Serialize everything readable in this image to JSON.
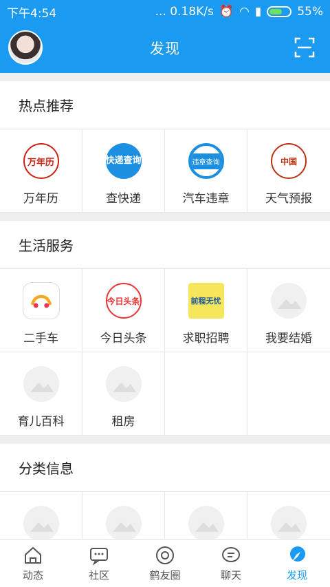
{
  "status": {
    "time": "下午4:54",
    "network": "... 0.18K/s",
    "battery": "55%"
  },
  "appbar": {
    "title": "发现"
  },
  "sections": [
    {
      "title": "热点推荐",
      "items": [
        {
          "label": "万年历",
          "icon": "calendar-icon",
          "text": "万年历"
        },
        {
          "label": "查快递",
          "icon": "express-icon",
          "text": "快递查询"
        },
        {
          "label": "汽车违章",
          "icon": "traffic-violation-icon",
          "text": "违章查询"
        },
        {
          "label": "天气预报",
          "icon": "weather-icon",
          "text": "中国"
        }
      ]
    },
    {
      "title": "生活服务",
      "items": [
        {
          "label": "二手车",
          "icon": "used-car-icon",
          "text": ""
        },
        {
          "label": "今日头条",
          "icon": "toutiao-icon",
          "text": "今日头条"
        },
        {
          "label": "求职招聘",
          "icon": "job-icon",
          "text": "前程无忧"
        },
        {
          "label": "我要结婚",
          "icon": "placeholder-image-icon",
          "text": ""
        },
        {
          "label": "育儿百科",
          "icon": "placeholder-image-icon",
          "text": ""
        },
        {
          "label": "租房",
          "icon": "placeholder-image-icon",
          "text": ""
        }
      ]
    },
    {
      "title": "分类信息"
    }
  ],
  "tabs": [
    {
      "label": "动态",
      "icon": "home-icon"
    },
    {
      "label": "社区",
      "icon": "community-icon"
    },
    {
      "label": "鹤友圈",
      "icon": "moments-icon"
    },
    {
      "label": "聊天",
      "icon": "chat-icon"
    },
    {
      "label": "发现",
      "icon": "discover-icon",
      "active": true
    }
  ]
}
